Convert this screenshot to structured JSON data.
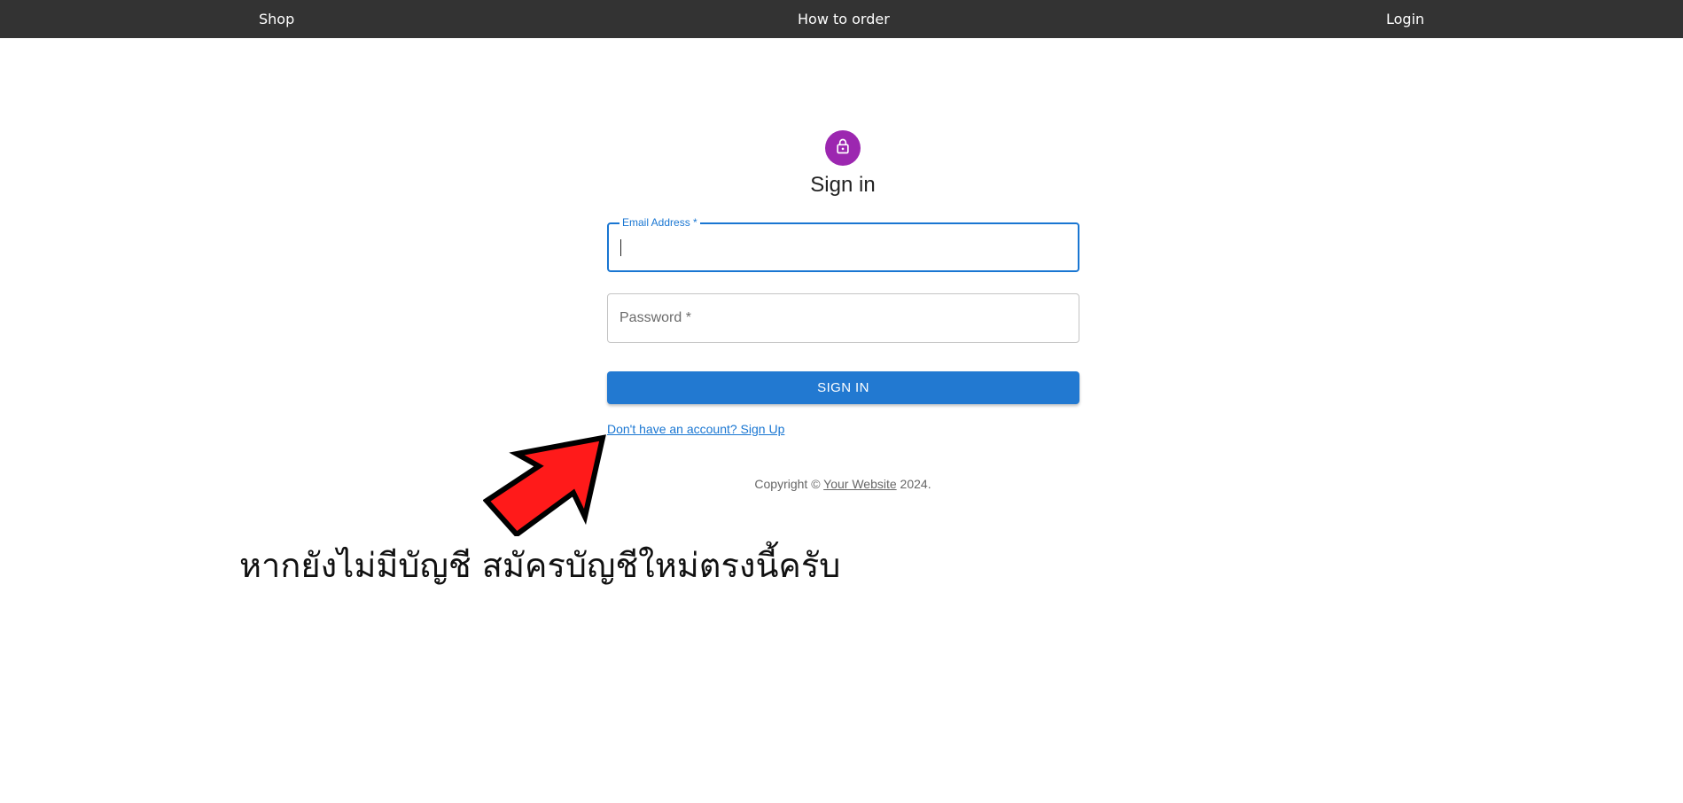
{
  "nav": {
    "shop": "Shop",
    "how_to_order": "How to order",
    "login": "Login"
  },
  "form": {
    "title": "Sign in",
    "lock_icon": "lock-outlined-icon",
    "email_label": "Email Address *",
    "email_value": "",
    "password_label": "Password *",
    "password_value": "",
    "submit_label": "SIGN IN",
    "signup_link": "Don't have an account? Sign Up"
  },
  "footer": {
    "prefix": "Copyright © ",
    "link_text": "Your Website",
    "suffix": " 2024."
  },
  "annotation": {
    "arrow_icon": "red-pointer-arrow",
    "text": "หากยังไม่มีบัญชี สมัครบัญชีใหม่ตรงนี้ครับ"
  },
  "colors": {
    "navbar": "#333333",
    "avatar": "#9c27b0",
    "primary": "#1976d2",
    "arrow": "#ff1a1a"
  }
}
